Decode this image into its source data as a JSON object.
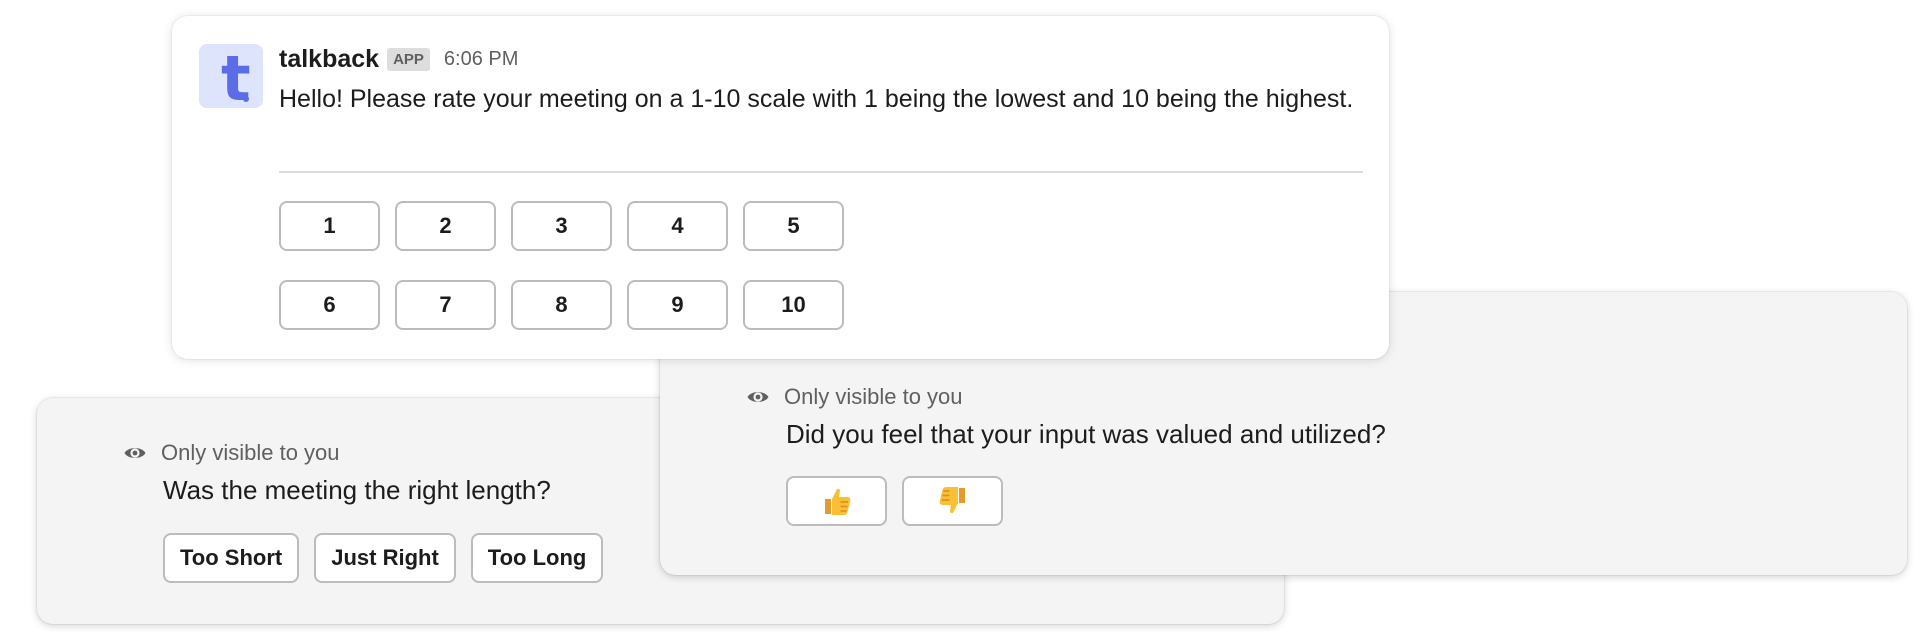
{
  "rating_message": {
    "app_name": "talkback",
    "badge": "APP",
    "time": "6:06 PM",
    "text": "Hello! Please rate your meeting on a 1-10 scale with 1 being the lowest and 10 being the highest.",
    "row1": [
      "1",
      "2",
      "3",
      "4",
      "5"
    ],
    "row2": [
      "6",
      "7",
      "8",
      "9",
      "10"
    ]
  },
  "length_card": {
    "visibility": "Only visible to you",
    "question": "Was the meeting the right length?",
    "options": [
      "Too Short",
      "Just Right",
      "Too Long"
    ]
  },
  "input_card": {
    "visibility": "Only visible to you",
    "question": "Did you feel that your input was valued and utilized?",
    "options": [
      "thumbs-up-icon",
      "thumbs-down-icon"
    ]
  },
  "colors": {
    "avatar_bg": "#dde4fb",
    "avatar_fg": "#5b6de6",
    "ephemeral_bg": "#f4f4f4"
  }
}
